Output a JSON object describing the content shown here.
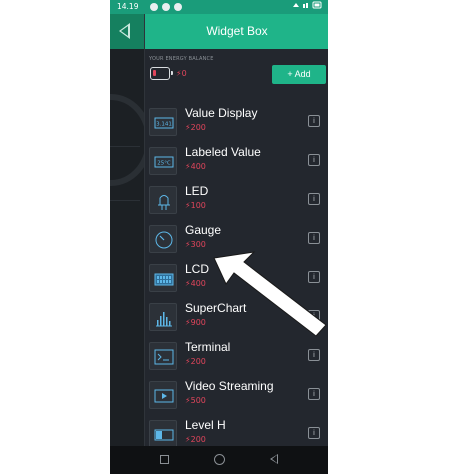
{
  "status_bar": {
    "time": "14.19"
  },
  "header": {
    "title": "Widget Box"
  },
  "energy": {
    "label": "YOUR ENERGY BALANCE",
    "value": "⚡0",
    "add_label": "+ Add"
  },
  "widgets": [
    {
      "name": "Value Display",
      "price": "⚡200",
      "icon": "value-display-icon",
      "thumb_text": "3.141"
    },
    {
      "name": "Labeled Value",
      "price": "⚡400",
      "icon": "labeled-value-icon",
      "thumb_text": "25°C"
    },
    {
      "name": "LED",
      "price": "⚡100",
      "icon": "led-icon"
    },
    {
      "name": "Gauge",
      "price": "⚡300",
      "icon": "gauge-icon"
    },
    {
      "name": "LCD",
      "price": "⚡400",
      "icon": "lcd-icon"
    },
    {
      "name": "SuperChart",
      "price": "⚡900",
      "icon": "superchart-icon"
    },
    {
      "name": "Terminal",
      "price": "⚡200",
      "icon": "terminal-icon"
    },
    {
      "name": "Video Streaming",
      "price": "⚡500",
      "icon": "video-streaming-icon"
    },
    {
      "name": "Level H",
      "price": "⚡200",
      "icon": "level-h-icon"
    }
  ],
  "info_label": "i",
  "colors": {
    "accent": "#1fb489",
    "price": "#e0455b",
    "background": "#23272e",
    "annotation": "#ffffff"
  }
}
